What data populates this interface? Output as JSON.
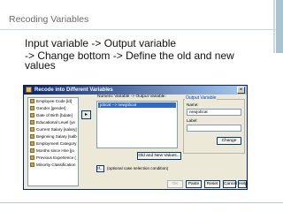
{
  "slide": {
    "title": "Recoding Variables",
    "bullet1": "Input variable  ->  Output variable",
    "bullet2": "->  Change bottom  ->  Define the old and new values"
  },
  "dialog": {
    "title": "Recode into Different Variables",
    "close_glyph": "×",
    "variables": [
      "Employee Code [id]",
      "Gender [gender]",
      "Date of Birth [bdate]",
      "Educational Level (ye",
      "Current Salary [salary]",
      "Beginning Salary [salb",
      "Employment Category",
      "Months since Hire [jo",
      "Previous Experience (",
      "Minority Classification"
    ],
    "arrow_glyph": "▸",
    "numeric_output_label": "Numeric Variable -> Output Variable:",
    "numeric_output_item": "jobcat --> newjobcat",
    "output_variable": {
      "legend": "Output Variable",
      "name_label": "Name:",
      "name_value": "newjobcat",
      "label_label": "Label:",
      "label_value": "",
      "change_button": "Change"
    },
    "old_new_button": "Old and New Values...",
    "if_button": "If...",
    "if_text": "(optional case selection condition)",
    "footer": {
      "ok": "OK",
      "paste": "Paste",
      "reset": "Reset",
      "cancel": "Cancel",
      "help": "Help"
    }
  },
  "colors": {
    "titlebar_start": "#0a246a",
    "titlebar_end": "#a6caf0",
    "selection": "#316ac5",
    "dialog_face": "#ece9d8"
  }
}
